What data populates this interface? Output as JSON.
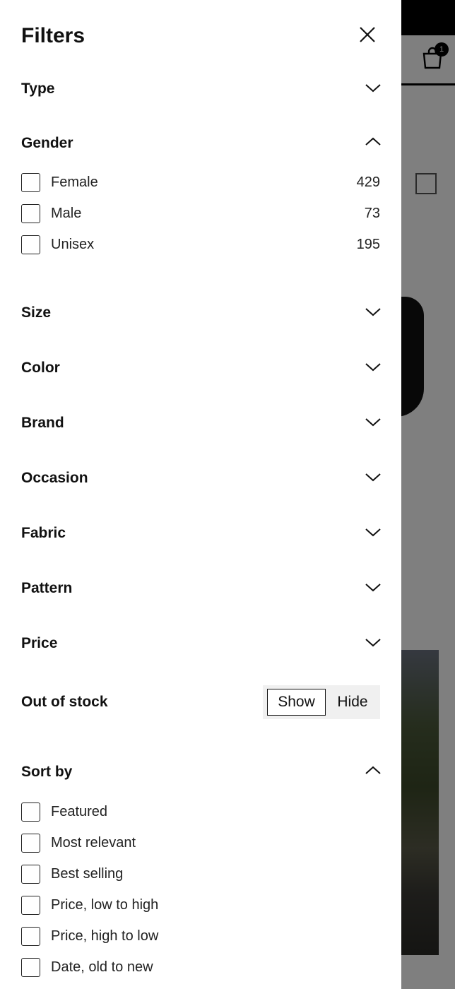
{
  "background": {
    "cart_badge": "1"
  },
  "panel": {
    "title": "Filters",
    "sections": [
      {
        "label": "Type",
        "expanded": false
      },
      {
        "label": "Gender",
        "expanded": true
      },
      {
        "label": "Size",
        "expanded": false
      },
      {
        "label": "Color",
        "expanded": false
      },
      {
        "label": "Brand",
        "expanded": false
      },
      {
        "label": "Occasion",
        "expanded": false
      },
      {
        "label": "Fabric",
        "expanded": false
      },
      {
        "label": "Pattern",
        "expanded": false
      },
      {
        "label": "Price",
        "expanded": false
      }
    ],
    "gender_options": [
      {
        "label": "Female",
        "count": "429",
        "checked": false
      },
      {
        "label": "Male",
        "count": "73",
        "checked": false
      },
      {
        "label": "Unisex",
        "count": "195",
        "checked": false
      }
    ],
    "out_of_stock": {
      "label": "Out of stock",
      "show_label": "Show",
      "hide_label": "Hide",
      "selected": "Show"
    },
    "sort_by": {
      "label": "Sort by",
      "expanded": true,
      "options": [
        {
          "label": "Featured",
          "checked": false
        },
        {
          "label": "Most relevant",
          "checked": false
        },
        {
          "label": "Best selling",
          "checked": false
        },
        {
          "label": "Price, low to high",
          "checked": false
        },
        {
          "label": "Price, high to low",
          "checked": false
        },
        {
          "label": "Date, old to new",
          "checked": false
        }
      ]
    }
  }
}
